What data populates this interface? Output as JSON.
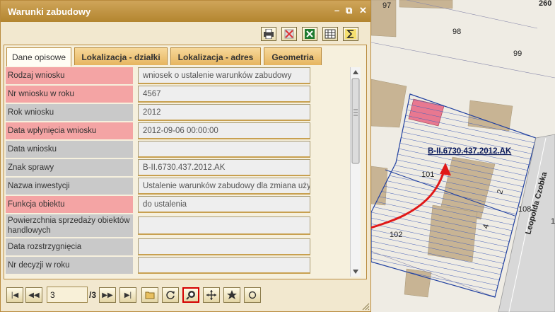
{
  "window": {
    "title": "Warunki zabudowy",
    "minimize_glyph": "–",
    "popout_glyph": "⧉",
    "close_glyph": "✕"
  },
  "toolbar": {
    "icons": [
      "print-icon",
      "delete-icon",
      "excel-export-icon",
      "table-icon",
      "sum-icon"
    ]
  },
  "tabs": [
    {
      "label": "Dane opisowe",
      "active": true
    },
    {
      "label": "Lokalizacja - działki",
      "active": false
    },
    {
      "label": "Lokalizacja - adres",
      "active": false
    },
    {
      "label": "Geometria",
      "active": false
    }
  ],
  "fields": [
    {
      "label": "Rodzaj wniosku",
      "value": "wniosek o ustalenie warunków zabudowy",
      "required": true
    },
    {
      "label": "Nr wniosku w roku",
      "value": "4567",
      "required": true
    },
    {
      "label": "Rok wniosku",
      "value": "2012",
      "required": false
    },
    {
      "label": "Data wpłynięcia wniosku",
      "value": "2012-09-06 00:00:00",
      "required": true
    },
    {
      "label": "Data wniosku",
      "value": "",
      "required": false
    },
    {
      "label": "Znak sprawy",
      "value": "B-II.6730.437.2012.AK",
      "required": false
    },
    {
      "label": "Nazwa inwestycji",
      "value": "Ustalenie warunków zabudowy dla zmiana użytkowania",
      "required": false
    },
    {
      "label": "Funkcja obiektu",
      "value": "do ustalenia",
      "required": true
    },
    {
      "label": "Powierzchnia sprzedaży obiektów handlowych",
      "value": "",
      "required": false
    },
    {
      "label": "Data rozstrzygnięcia",
      "value": "",
      "required": false
    },
    {
      "label": "Nr decyzji w roku",
      "value": "",
      "required": false
    }
  ],
  "navigation": {
    "current_record": "3",
    "total_label": "/3",
    "first_glyph": "|◀",
    "prev_glyph": "◀◀",
    "next_glyph": "▶▶",
    "last_glyph": "▶|"
  },
  "map": {
    "parcel_label": "B-II.6730.437.2012.AK",
    "street_name": "Leopolda Czobka",
    "numbers": [
      "97",
      "98",
      "99",
      "101",
      "102",
      "108",
      "260",
      "2",
      "4",
      "1"
    ],
    "colors": {
      "background": "#efece4",
      "building": "#c8b494",
      "highlight_building": "#e87890",
      "parcel_border": "#2040a0",
      "arrow": "#e01818"
    }
  }
}
